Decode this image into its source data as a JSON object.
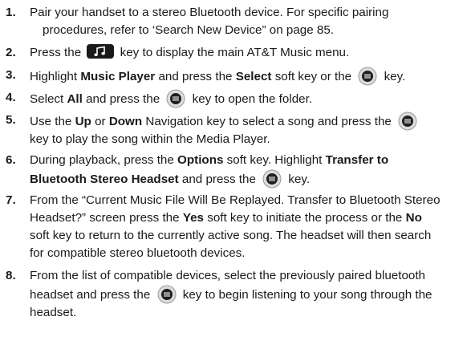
{
  "steps": [
    {
      "num": "1.",
      "a": "Pair your handset to a stereo Bluetooth device. For specific pairing",
      "b": "procedures, refer to ‘Search New Device” on page 85."
    },
    {
      "num": "2.",
      "a": "Press the",
      "b": "key to display the main AT&T Music menu.",
      "icon": "music-key-icon"
    },
    {
      "num": "3.",
      "a": "Highlight",
      "b1": "Music Player",
      "c": "and press the",
      "d1": "Select",
      "e": "soft key or the",
      "f": "key.",
      "icon": "select-key-icon"
    },
    {
      "num": "4.",
      "a": "Select",
      "b1": "All",
      "c": "and press the",
      "e": "key to open the folder.",
      "icon": "select-key-icon"
    },
    {
      "num": "5.",
      "a": "Use the",
      "b1": "Up",
      "c": "or",
      "d1": "Down",
      "e": "Navigation key to select a song and press the",
      "f": "key to play the song within the Media Player.",
      "icon": "select-key-icon"
    },
    {
      "num": "6.",
      "a": "During playback, press the",
      "b1": "Options",
      "c": "soft key. Highlight",
      "d1": "Transfer to",
      "d2": "Bluetooth Stereo Headset",
      "e": "and press the",
      "f": "key.",
      "icon": "select-key-icon"
    },
    {
      "num": "7.",
      "a": "From the “Current Music File Will Be Replayed. Transfer to Bluetooth Stereo",
      "b": "Headset?” screen press the",
      "c1": "Yes",
      "d": "soft key to initiate the process or the",
      "e1": "No",
      "f": "soft key to return to the currently active song. The headset will then search",
      "g": "for compatible stereo bluetooth devices."
    },
    {
      "num": "8.",
      "a": "From the list of compatible devices, select the previously paired bluetooth",
      "b": "headset and press the",
      "c": "key to begin listening to your song through the",
      "d": "headset.",
      "icon": "select-key-icon"
    }
  ]
}
